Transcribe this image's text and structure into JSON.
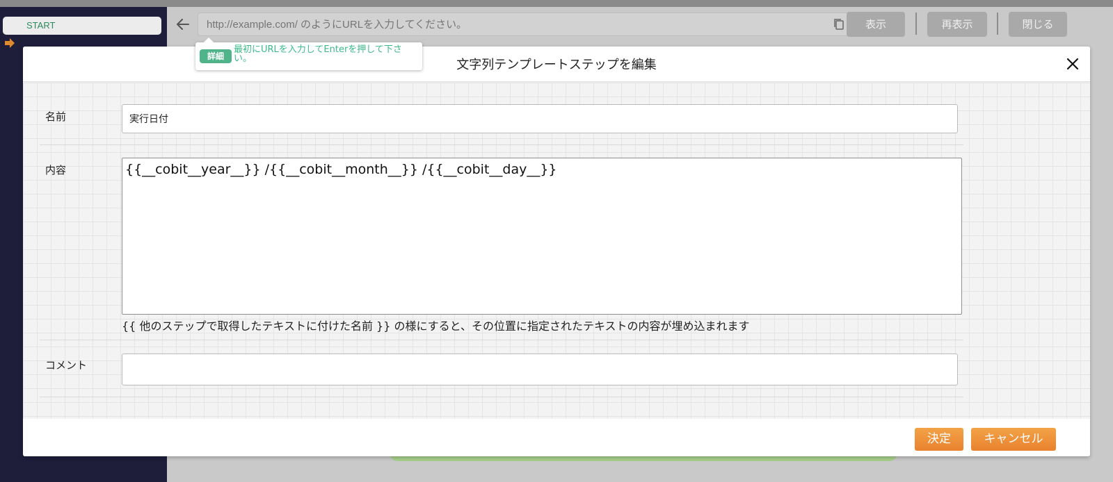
{
  "sidebar": {
    "start_label": "START"
  },
  "topbar": {
    "url_placeholder": "http://example.com/ のようにURLを入力してください。",
    "show_label": "表示",
    "reload_label": "再表示",
    "close_label": "閉じる"
  },
  "tooltip": {
    "badge": "詳細",
    "text": "最初にURLを入力してEnterを押して下さい。"
  },
  "modal": {
    "title": "文字列テンプレートステップを編集",
    "name_label": "名前",
    "name_value": "実行日付",
    "content_label": "内容",
    "content_value": "{{__cobit__year__}} /{{__cobit__month__}} /{{__cobit__day__}}",
    "hint": "{{ 他のステップで取得したテキストに付けた名前 }} の様にすると、その位置に指定されたテキストの内容が埋め込まれます",
    "comment_label": "コメント",
    "comment_value": "",
    "ok_label": "決定",
    "cancel_label": "キャンセル"
  },
  "colors": {
    "sidebar_bg": "#1e1d3a",
    "accent_orange": "#e9822f",
    "tooltip_green": "#4fb48a"
  },
  "icons": [
    "arrow-right-icon",
    "back-arrow-icon",
    "copy-icon",
    "close-icon"
  ]
}
